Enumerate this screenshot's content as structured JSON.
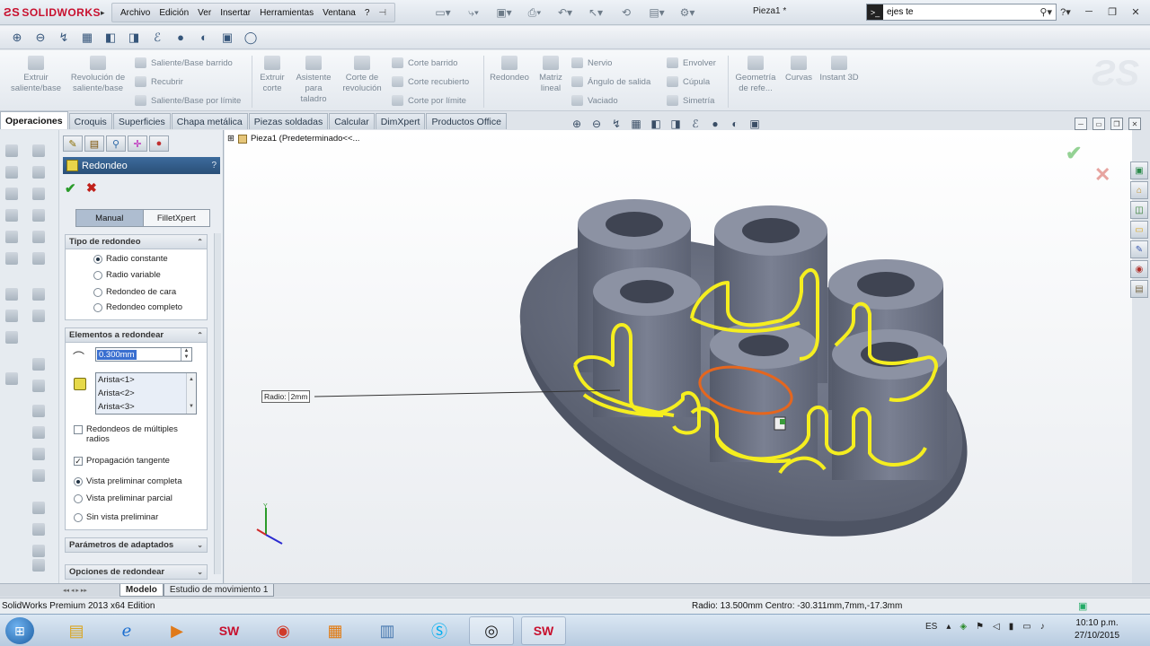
{
  "app": {
    "logo": "SOLIDWORKS",
    "document_title": "Pieza1 *",
    "menu": [
      "Archivo",
      "Edición",
      "Ver",
      "Insertar",
      "Herramientas",
      "Ventana",
      "?"
    ],
    "search_value": "ejes te"
  },
  "command_manager": {
    "big": [
      {
        "label": "Extruir saliente/base"
      },
      {
        "label": "Revolución de saliente/base"
      },
      {
        "label": "Extruir corte"
      },
      {
        "label": "Asistente para taladro"
      },
      {
        "label": "Corte de revolución"
      },
      {
        "label": "Redondeo"
      },
      {
        "label": "Matriz lineal"
      },
      {
        "label": "Geometría de refe..."
      },
      {
        "label": "Curvas"
      },
      {
        "label": "Instant 3D"
      }
    ],
    "small": [
      {
        "label": "Saliente/Base barrido"
      },
      {
        "label": "Recubrir"
      },
      {
        "label": "Saliente/Base por límite"
      },
      {
        "label": "Corte barrido"
      },
      {
        "label": "Corte recubierto"
      },
      {
        "label": "Corte por límite"
      },
      {
        "label": "Nervio"
      },
      {
        "label": "Ángulo de salida"
      },
      {
        "label": "Vaciado"
      },
      {
        "label": "Envolver"
      },
      {
        "label": "Cúpula"
      },
      {
        "label": "Simetría"
      }
    ]
  },
  "tabs": [
    "Operaciones",
    "Croquis",
    "Superficies",
    "Chapa metálica",
    "Piezas soldadas",
    "Calcular",
    "DimXpert",
    "Productos Office"
  ],
  "property_manager": {
    "title": "Redondeo",
    "help": "?",
    "mode_manual": "Manual",
    "mode_filletxpert": "FilletXpert",
    "tipo": {
      "header": "Tipo de redondeo",
      "options": [
        "Radio constante",
        "Radio variable",
        "Redondeo de cara",
        "Redondeo completo"
      ]
    },
    "elementos": {
      "header": "Elementos a redondear",
      "radius_value": "0.300mm",
      "edges": [
        "Arista<1>",
        "Arista<2>",
        "Arista<3>"
      ],
      "multi_radius": "Redondeos de múltiples radios",
      "tangent": "Propagación tangente",
      "preview_full": "Vista preliminar completa",
      "preview_partial": "Vista preliminar parcial",
      "preview_none": "Sin vista preliminar"
    },
    "params_header": "Parámetros de adaptados",
    "options_header": "Opciones de redondear"
  },
  "viewport": {
    "tree_root": "Pieza1  (Predeterminado<<...",
    "callout_label": "Radio:",
    "callout_value": "2mm"
  },
  "bottom_tabs": [
    "Modelo",
    "Estudio de movimiento 1"
  ],
  "status": {
    "left": "SolidWorks Premium 2013 x64 Edition",
    "right": "Radio: 13.500mm  Centro: -30.311mm,7mm,-17.3mm"
  },
  "taskbar": {
    "lang": "ES",
    "time": "10:10 p.m.",
    "date": "27/10/2015"
  },
  "colors": {
    "model_body": "#6d7384",
    "edge_highlight": "#f5ee1f",
    "selected_edge": "#e5661e",
    "pm_title": "#2f5986"
  }
}
